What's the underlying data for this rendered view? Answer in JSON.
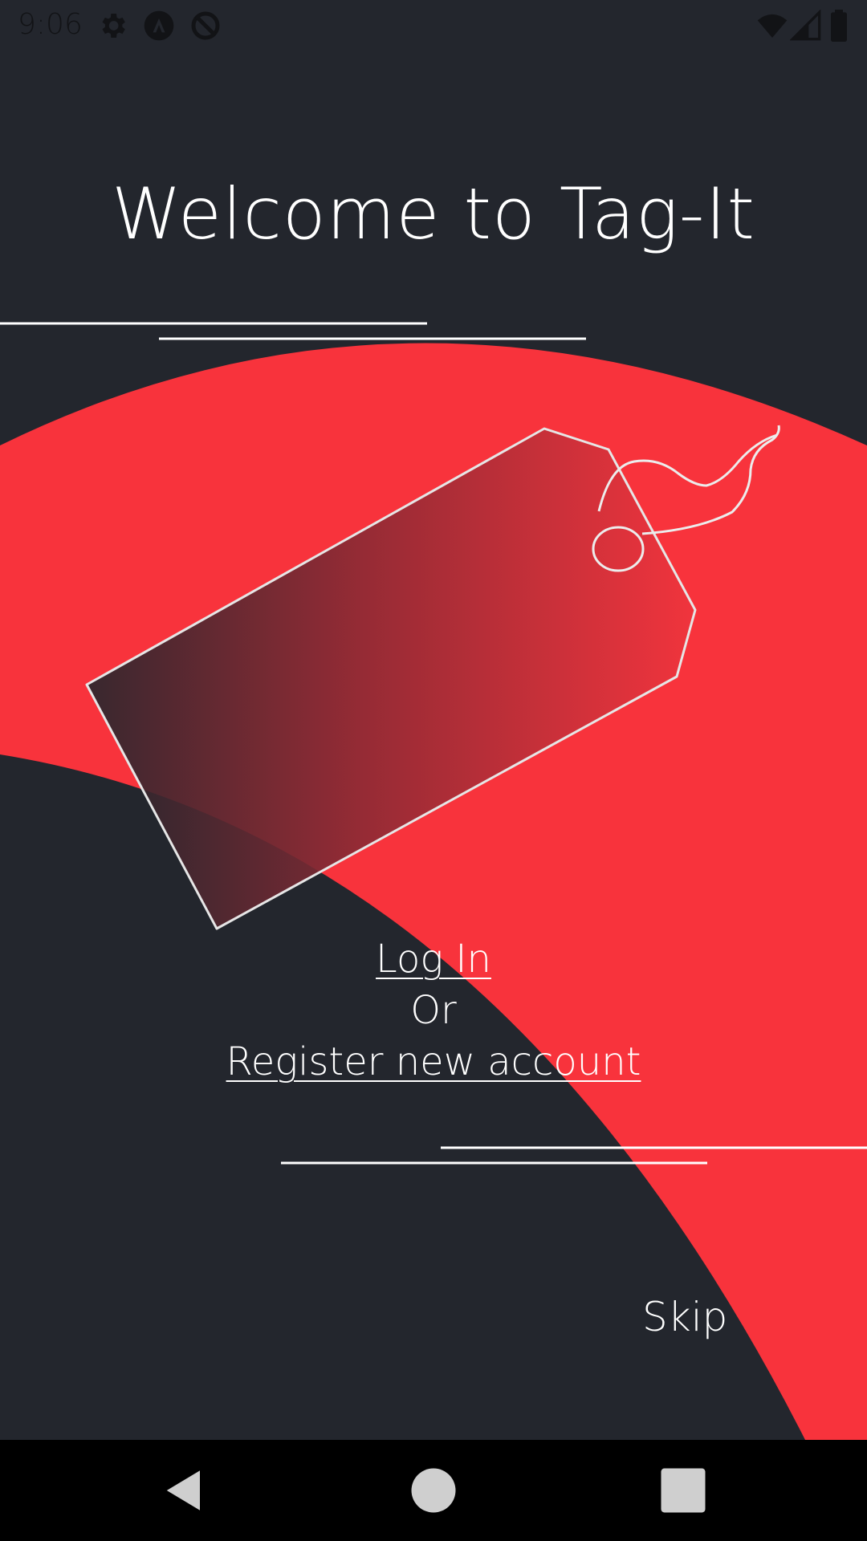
{
  "status_bar": {
    "time": "9:06",
    "left_icons": [
      "settings-icon",
      "nav-a-icon",
      "no-sync-icon"
    ],
    "right_icons": [
      "wifi-icon",
      "signal-icon",
      "battery-icon"
    ]
  },
  "title": "Welcome to Tag-It",
  "auth": {
    "login_label": "Log In",
    "or_label": "Or",
    "register_label": "Register new account"
  },
  "skip_label": "Skip",
  "nav_bar": {
    "buttons": [
      "back-icon",
      "home-icon",
      "recents-icon"
    ]
  },
  "colors": {
    "background": "#23262d",
    "accent": "#f8333c",
    "text": "#ffffff"
  }
}
